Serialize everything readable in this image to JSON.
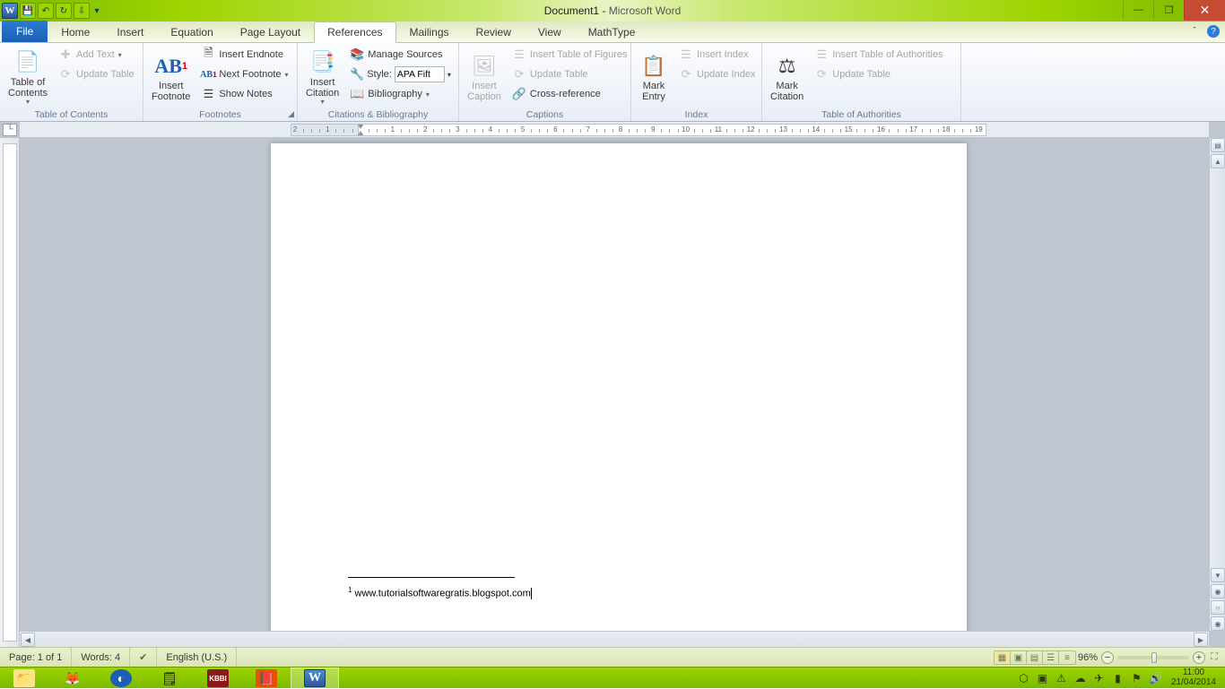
{
  "title": {
    "doc": "Document1",
    "sep": " - ",
    "app": "Microsoft Word"
  },
  "tabs": {
    "file": "File",
    "items": [
      "Home",
      "Insert",
      "Equation",
      "Page Layout",
      "References",
      "Mailings",
      "Review",
      "View",
      "MathType"
    ],
    "active": "References"
  },
  "ribbon": {
    "toc": {
      "big": "Table of\nContents",
      "add_text": "Add Text",
      "update_table": "Update Table",
      "label": "Table of Contents"
    },
    "footnotes": {
      "big": "Insert\nFootnote",
      "ab_icon": "AB¹",
      "insert_endnote": "Insert Endnote",
      "next_footnote": "Next Footnote",
      "show_notes": "Show Notes",
      "label": "Footnotes"
    },
    "citations": {
      "big": "Insert\nCitation",
      "manage_sources": "Manage Sources",
      "style_label": "Style:",
      "style_value": "APA Fift",
      "bibliography": "Bibliography",
      "label": "Citations & Bibliography"
    },
    "captions": {
      "big": "Insert\nCaption",
      "insert_tof": "Insert Table of Figures",
      "update_table": "Update Table",
      "cross_ref": "Cross-reference",
      "label": "Captions"
    },
    "index": {
      "big": "Mark\nEntry",
      "insert_index": "Insert Index",
      "update_index": "Update Index",
      "label": "Index"
    },
    "toa": {
      "big": "Mark\nCitation",
      "insert_toa": "Insert Table of Authorities",
      "update_table": "Update Table",
      "label": "Table of Authorities"
    }
  },
  "ruler_numbers": [
    "2",
    "1",
    "",
    "1",
    "2",
    "3",
    "4",
    "5",
    "6",
    "7",
    "8",
    "9",
    "10",
    "11",
    "12",
    "13",
    "14",
    "15",
    "16",
    "17",
    "18",
    "19"
  ],
  "document": {
    "footnote_num": "1",
    "footnote_text": "www.tutorialsoftwaregratis.blogspot.com"
  },
  "status": {
    "page": "Page: 1 of 1",
    "words": "Words: 4",
    "lang": "English (U.S.)",
    "zoom": "96%"
  },
  "clock": {
    "time": "11:00",
    "date": "21/04/2014"
  }
}
